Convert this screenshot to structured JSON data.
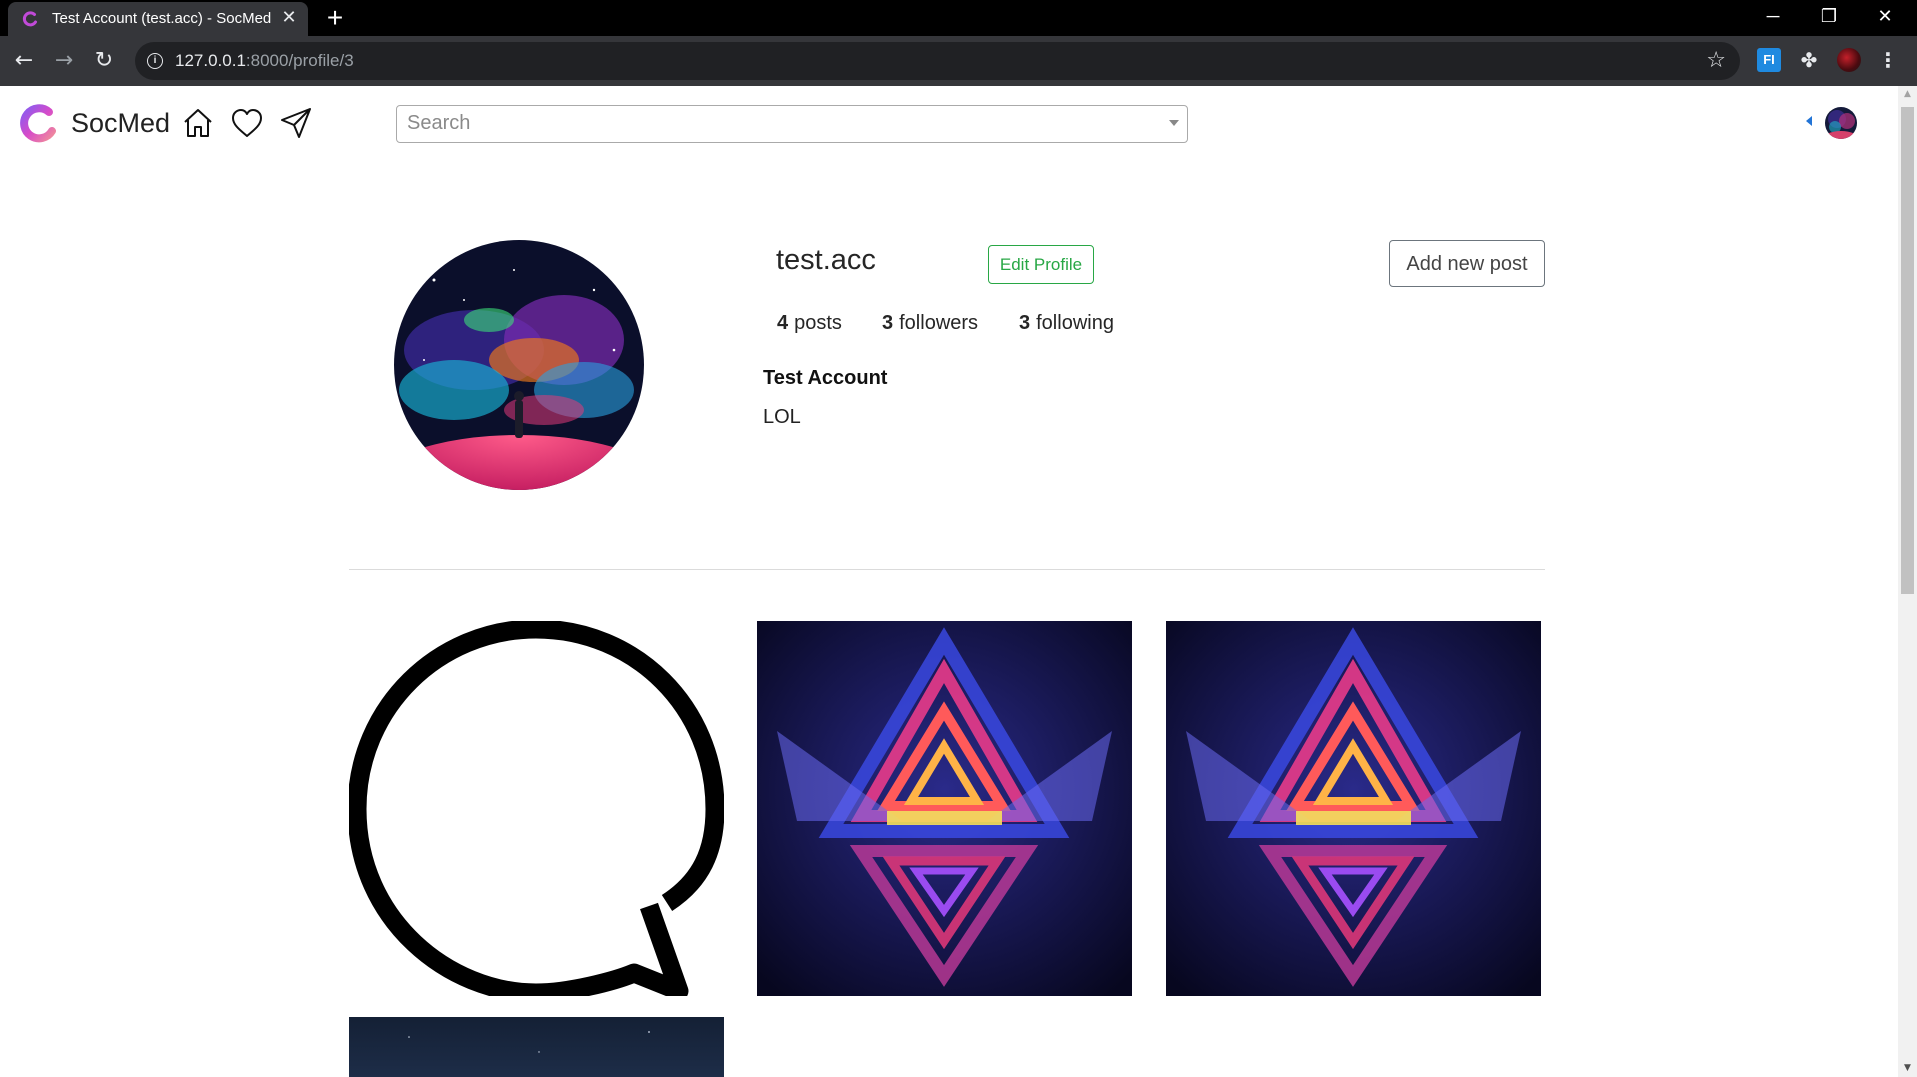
{
  "browser": {
    "tab_title": "Test Account (test.acc) - SocMed",
    "url_host": "127.0.0.1",
    "url_rest": ":8000/profile/3",
    "icons": {
      "back": "arrow-left-icon",
      "forward": "arrow-right-icon",
      "reload": "reload-icon",
      "bookmark": "star-icon",
      "extensions": "puzzle-icon",
      "menu": "kebab-menu-icon"
    }
  },
  "navbar": {
    "brand_name": "SocMed",
    "search_placeholder": "Search",
    "icons": [
      "home-icon",
      "heart-icon",
      "send-icon"
    ]
  },
  "profile": {
    "username": "test.acc",
    "edit_profile_label": "Edit Profile",
    "add_post_label": "Add new post",
    "stats": {
      "posts_count": "4",
      "posts_label": "posts",
      "followers_count": "3",
      "followers_label": "followers",
      "following_count": "3",
      "following_label": "following"
    },
    "full_name": "Test Account",
    "bio": "LOL"
  },
  "posts": [
    {
      "kind": "chat-bubble-outline"
    },
    {
      "kind": "neon-triangles-art"
    },
    {
      "kind": "neon-triangles-art"
    },
    {
      "kind": "night-sky-photo"
    }
  ],
  "colors": {
    "accent_green": "#28a745",
    "outline_gray": "#6c757d",
    "chrome_dark": "#35363a",
    "link_blue": "#2274d6"
  }
}
